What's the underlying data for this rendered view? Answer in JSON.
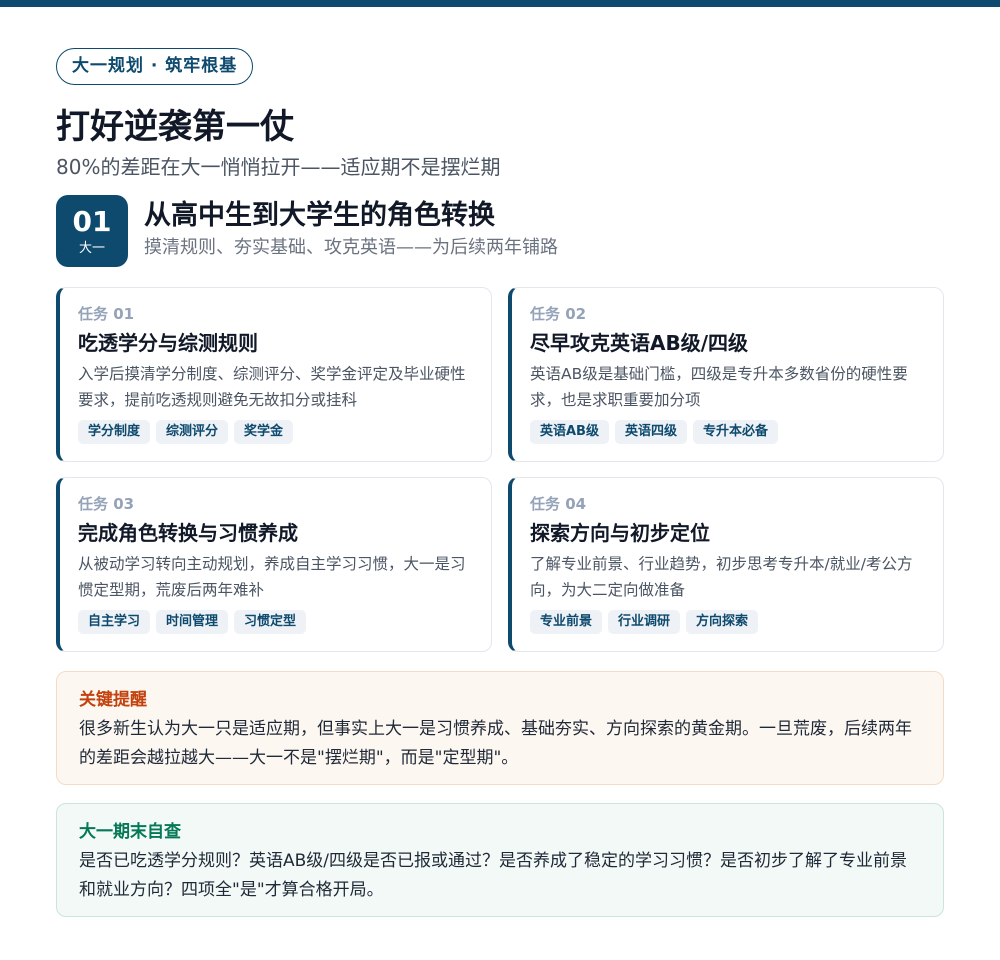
{
  "header": {
    "badge": "大一规划 · 筑牢根基",
    "title": "打好逆袭第一仗",
    "subtitle": "80%的差距在大一悄悄拉开——适应期不是摆烂期"
  },
  "section": {
    "number": "01",
    "number_label": "大一",
    "title": "从高中生到大学生的角色转换",
    "subtitle": "摸清规则、夯实基础、攻克英语——为后续两年铺路"
  },
  "tasks": [
    {
      "tag": "任务 01",
      "title": "吃透学分与综测规则",
      "desc": "入学后摸清学分制度、综测评分、奖学金评定及毕业硬性要求，提前吃透规则避免无故扣分或挂科",
      "chips": [
        "学分制度",
        "综测评分",
        "奖学金"
      ]
    },
    {
      "tag": "任务 02",
      "title": "尽早攻克英语AB级/四级",
      "desc": "英语AB级是基础门槛，四级是专升本多数省份的硬性要求，也是求职重要加分项",
      "chips": [
        "英语AB级",
        "英语四级",
        "专升本必备"
      ]
    },
    {
      "tag": "任务 03",
      "title": "完成角色转换与习惯养成",
      "desc": "从被动学习转向主动规划，养成自主学习习惯，大一是习惯定型期，荒废后两年难补",
      "chips": [
        "自主学习",
        "时间管理",
        "习惯定型"
      ]
    },
    {
      "tag": "任务 04",
      "title": "探索方向与初步定位",
      "desc": "了解专业前景、行业趋势，初步思考专升本/就业/考公方向，为大二定向做准备",
      "chips": [
        "专业前景",
        "行业调研",
        "方向探索"
      ]
    }
  ],
  "reminder": {
    "title": "关键提醒",
    "text": "很多新生认为大一只是适应期，但事实上大一是习惯养成、基础夯实、方向探索的黄金期。一旦荒废，后续两年的差距会越拉越大——大一不是\"摆烂期\"，而是\"定型期\"。"
  },
  "checklist": {
    "title": "大一期末自查",
    "text": "是否已吃透学分规则？英语AB级/四级是否已报或通过？是否养成了稳定的学习习惯？是否初步了解了专业前景和就业方向？四项全\"是\"才算合格开局。"
  },
  "colors": {
    "primary": "#0e4a6e",
    "warn": "#c2410c",
    "ok": "#047857"
  }
}
